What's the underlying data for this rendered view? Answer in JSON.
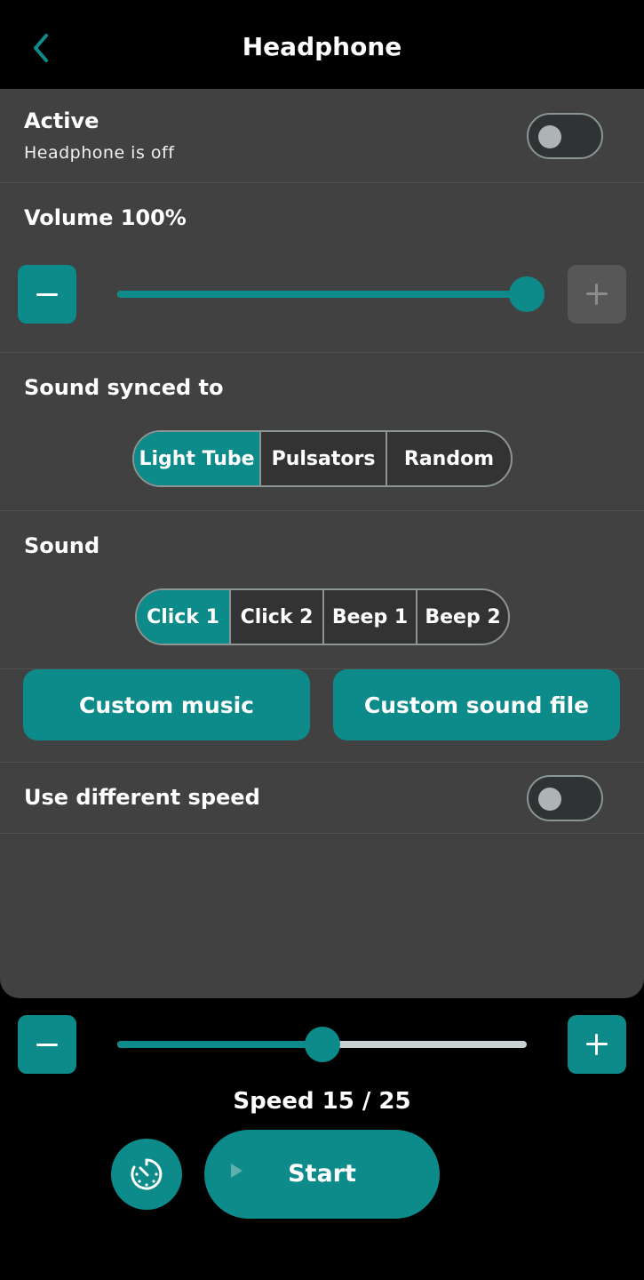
{
  "header": {
    "title": "Headphone"
  },
  "active": {
    "label": "Active",
    "status": "Headphone is off",
    "on": false
  },
  "volume": {
    "label": "Volume 100%",
    "level_percent": 100
  },
  "sound_synced": {
    "label": "Sound synced to",
    "options": [
      "Light Tube",
      "Pulsators",
      "Random"
    ],
    "selected": "Light Tube"
  },
  "sound": {
    "label": "Sound",
    "options": [
      "Click 1",
      "Click 2",
      "Beep 1",
      "Beep 2"
    ],
    "selected": "Click 1"
  },
  "custom": {
    "music_label": "Custom music",
    "sound_file_label": "Custom sound file"
  },
  "different_speed": {
    "label": "Use different speed",
    "on": false
  },
  "speed": {
    "label": "Speed 15 / 25",
    "value": 15,
    "max": 25
  },
  "controls": {
    "start_label": "Start"
  },
  "colors": {
    "accent": "#0d8b8a",
    "panel": "#414141",
    "background": "#000000"
  }
}
